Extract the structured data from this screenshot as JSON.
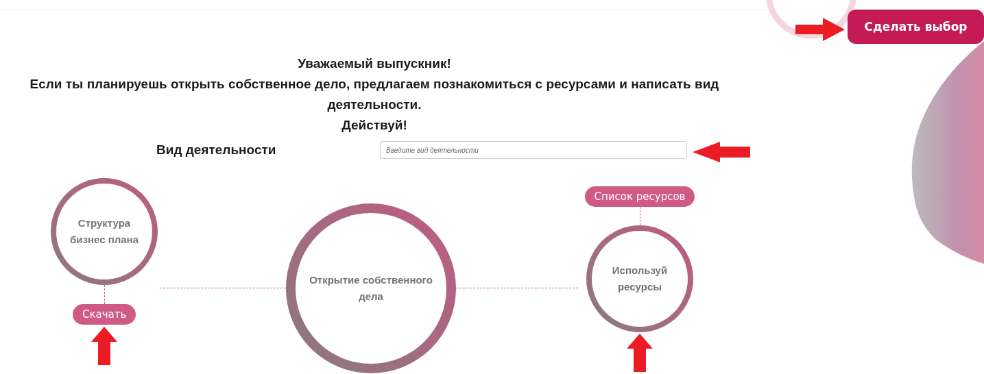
{
  "choose_button": "Сделать выбор",
  "heading": [
    "Уважаемый выпускник!",
    "Если ты планируешь открыть собственное дело, предлагаем познакомиться с ресурсами и написать вид деятельности.",
    "Действуй!"
  ],
  "activity": {
    "label": "Вид деятельности",
    "placeholder": "Введите вид деятельности"
  },
  "diagram": {
    "nodes": [
      {
        "kind": "lower",
        "text": "Структура бизнес плана",
        "button": "Скачать"
      },
      {
        "kind": "center",
        "text": "Открытие собственного дела"
      },
      {
        "kind": "upper",
        "text": "Используй ресурсы",
        "button": "Список ресурсов"
      }
    ]
  }
}
